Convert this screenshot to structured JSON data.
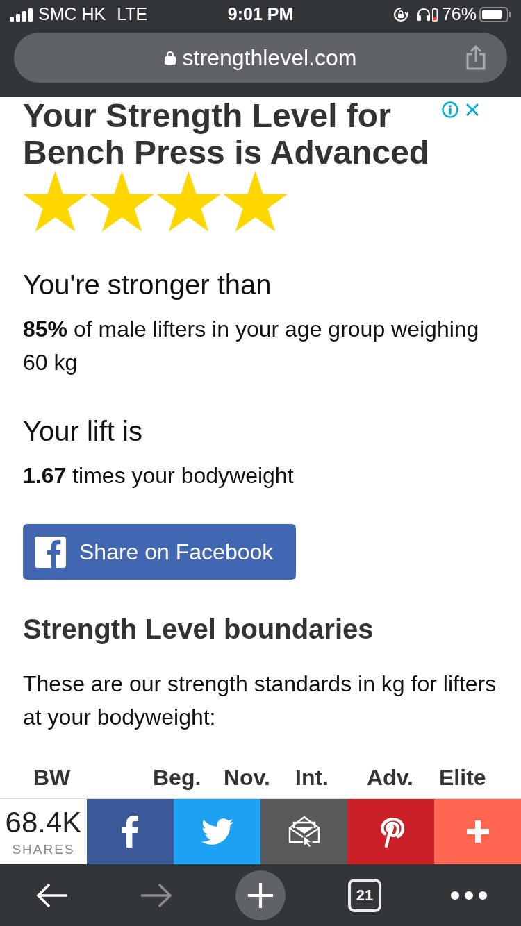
{
  "status_bar": {
    "carrier": "SMC HK",
    "network": "LTE",
    "time": "9:01 PM",
    "battery": "76%"
  },
  "address_bar": {
    "url": "strengthlevel.com"
  },
  "result": {
    "title": "Your Strength Level for Bench Press is Advanced",
    "stars": 4
  },
  "stats": [
    {
      "heading": "You're stronger than",
      "text": "**85%** of male lifters in your age group weighing 60 kg"
    },
    {
      "heading": "Your lift is",
      "text": "**1.67** times your bodyweight"
    }
  ],
  "share_button": {
    "label": "Share on Facebook"
  },
  "boundaries": {
    "heading": "Strength Level boundaries",
    "intro": "These are our strength standards in kg for lifters at your bodyweight:",
    "columns": [
      "BW",
      "Beg.",
      "Nov.",
      "Int.",
      "Adv.",
      "Elite"
    ]
  },
  "share_bar": {
    "count": "68.4K",
    "count_label": "SHARES",
    "buttons": [
      {
        "kind": "facebook",
        "color": "#3b5998"
      },
      {
        "kind": "twitter",
        "color": "#1da1f2"
      },
      {
        "kind": "email",
        "color": "#595959"
      },
      {
        "kind": "pinterest",
        "color": "#cb2027"
      },
      {
        "kind": "more",
        "color": "#ff6550"
      }
    ]
  },
  "toolbar": {
    "back": {
      "disabled": false
    },
    "forward": {
      "disabled": true
    },
    "tab_count": "21"
  }
}
